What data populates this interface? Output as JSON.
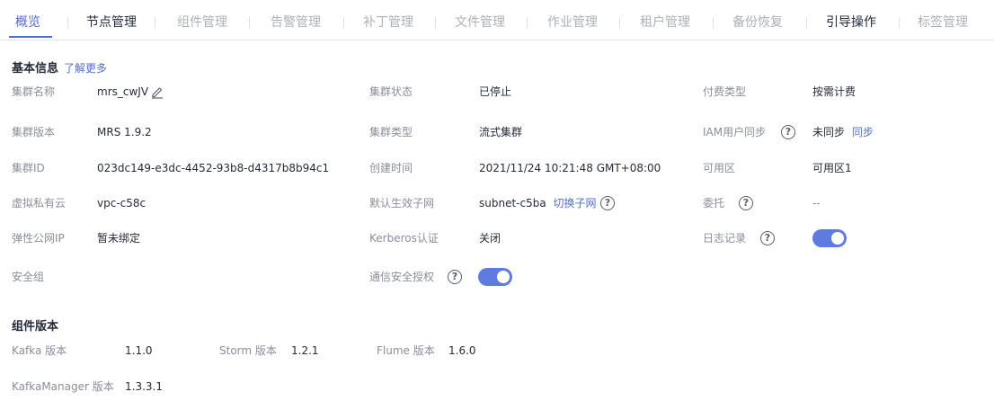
{
  "tabs": [
    {
      "label": "概览"
    },
    {
      "label": "节点管理"
    },
    {
      "label": "组件管理"
    },
    {
      "label": "告警管理"
    },
    {
      "label": "补丁管理"
    },
    {
      "label": "文件管理"
    },
    {
      "label": "作业管理"
    },
    {
      "label": "租户管理"
    },
    {
      "label": "备份恢复"
    },
    {
      "label": "引导操作"
    },
    {
      "label": "标签管理"
    }
  ],
  "basic": {
    "title": "基本信息",
    "learn_more": "了解更多",
    "cluster_name": {
      "label": "集群名称",
      "value": "mrs_cwJV"
    },
    "cluster_version": {
      "label": "集群版本",
      "value": "MRS 1.9.2"
    },
    "cluster_id": {
      "label": "集群ID",
      "value": "023dc149-e3dc-4452-93b8-d4317b8b94c1"
    },
    "vpc": {
      "label": "虚拟私有云",
      "value": "vpc-c58c"
    },
    "eip": {
      "label": "弹性公网IP",
      "value": "暂未绑定"
    },
    "security_group": {
      "label": "安全组",
      "value": ""
    },
    "cluster_status": {
      "label": "集群状态",
      "value": "已停止"
    },
    "cluster_type": {
      "label": "集群类型",
      "value": "流式集群"
    },
    "created_time": {
      "label": "创建时间",
      "value": "2021/11/24 10:21:48 GMT+08:00"
    },
    "default_subnet": {
      "label": "默认生效子网",
      "value": "subnet-c5ba",
      "switch_link": "切换子网"
    },
    "kerberos": {
      "label": "Kerberos认证",
      "value": "关闭"
    },
    "comm_auth": {
      "label": "通信安全授权",
      "enabled": true
    },
    "billing_type": {
      "label": "付费类型",
      "value": "按需计费"
    },
    "iam_sync": {
      "label": "IAM用户同步",
      "value": "未同步",
      "sync_link": "同步"
    },
    "az": {
      "label": "可用区",
      "value": "可用区1"
    },
    "agency": {
      "label": "委托",
      "value": "--"
    },
    "log_record": {
      "label": "日志记录",
      "enabled": true
    },
    "help_glyph": "?"
  },
  "components": {
    "title": "组件版本",
    "kafka": {
      "label": "Kafka 版本",
      "value": "1.1.0"
    },
    "storm": {
      "label": "Storm 版本",
      "value": "1.2.1"
    },
    "flume": {
      "label": "Flume 版本",
      "value": "1.6.0"
    },
    "kafka_manager": {
      "label": "KafkaManager 版本",
      "value": "1.3.3.1"
    }
  },
  "colors": {
    "accent": "#526ecc",
    "toggle_on": "#5e7ce0",
    "label": "#8a8e99",
    "text": "#252b3a"
  },
  "icons": {
    "edit": "pencil-icon",
    "help": "help-circle-icon"
  }
}
